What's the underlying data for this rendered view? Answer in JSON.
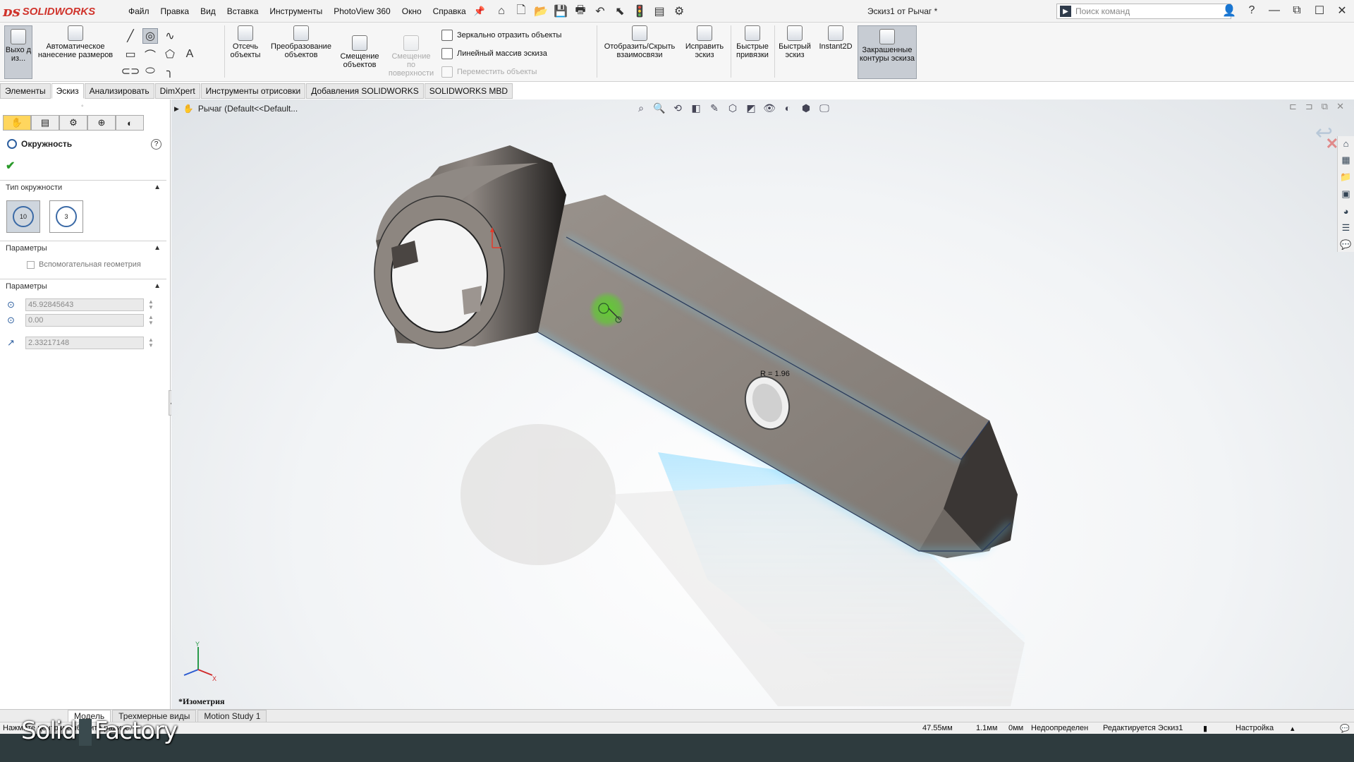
{
  "app": {
    "brand": "SOLIDWORKS",
    "menu": [
      "Файл",
      "Правка",
      "Вид",
      "Вставка",
      "Инструменты",
      "PhotoView 360",
      "Окно",
      "Справка"
    ],
    "document_title": "Эскиз1 от Рычаг *",
    "search_placeholder": "Поиск команд"
  },
  "command_manager": {
    "exit_sketch": "Выхо д из...",
    "smart_dimension": "Автоматическое нанесение размеров",
    "trim": "Отсечь объекты",
    "convert": "Преобразование объектов",
    "offset": "Смещение объектов",
    "offset_surface": "Смещение по поверхности",
    "mirror": "Зеркально отразить объекты",
    "linear_pattern": "Линейный массив эскиза",
    "move": "Переместить объекты",
    "display_relations": "Отобразить/Скрыть взаимосвязи",
    "repair": "Исправить эскиз",
    "quick_snaps": "Быстрые привязки",
    "rapid_sketch": "Быстрый эскиз",
    "instant2d": "Instant2D",
    "shaded_contours": "Закрашенные контуры эскиза"
  },
  "tabs": [
    "Элементы",
    "Эскиз",
    "Анализировать",
    "DimXpert",
    "Инструменты отрисовки",
    "Добавления SOLIDWORKS",
    "SOLIDWORKS MBD"
  ],
  "property_manager": {
    "title": "Окружность",
    "section_type": "Тип окружности",
    "section_options": "Параметры",
    "construction": "Вспомогательная геометрия",
    "section_params": "Параметры",
    "cx": "45.92845643",
    "cy": "0.00",
    "radius": "2.33217148",
    "type_center_label": "10",
    "type_perimeter_label": "3"
  },
  "viewport": {
    "tree_root": "Рычаг  (Default<<Default...",
    "dim_label": "R = 1.96",
    "view_name": "*Изометрия",
    "triad_x": "X",
    "triad_y": "Y"
  },
  "bottom_tabs": [
    "Модель",
    "Трехмерные виды",
    "Motion Study 1"
  ],
  "status": {
    "prompt": "Нажмите центр и выберите радиус.",
    "x": "47.55мм",
    "y": "1.1мм",
    "z": "0мм",
    "state": "Недоопределен",
    "editing": "Редактируется Эскиз1",
    "settings": "Настройка"
  },
  "overlay": {
    "left": "Solid",
    "right": "Factory"
  },
  "colors": {
    "accent": "#d0342c",
    "selection_glow": "#6fd2ff",
    "cursor_green": "#5cd02a"
  }
}
